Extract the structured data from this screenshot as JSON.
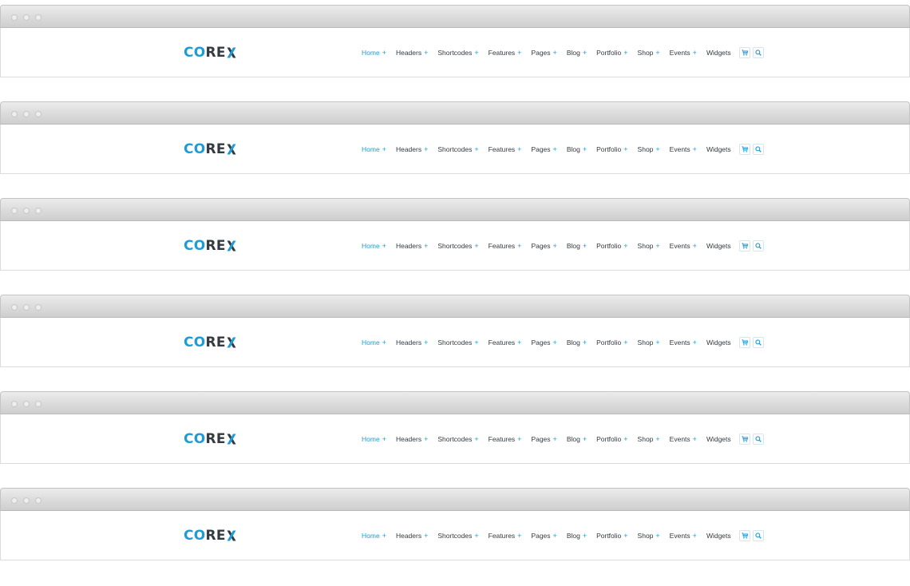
{
  "brand": {
    "logo_co": "CO",
    "logo_re": "RE",
    "accent_color": "#1e9cd7",
    "text_color": "#333a40"
  },
  "menu": {
    "items": [
      {
        "label": "Home",
        "has_plus": true,
        "active": true
      },
      {
        "label": "Headers",
        "has_plus": true,
        "active": false
      },
      {
        "label": "Shortcodes",
        "has_plus": true,
        "active": false
      },
      {
        "label": "Features",
        "has_plus": true,
        "active": false
      },
      {
        "label": "Pages",
        "has_plus": true,
        "active": false
      },
      {
        "label": "Blog",
        "has_plus": true,
        "active": false
      },
      {
        "label": "Portfolio",
        "has_plus": true,
        "active": false
      },
      {
        "label": "Shop",
        "has_plus": true,
        "active": false
      },
      {
        "label": "Events",
        "has_plus": true,
        "active": false
      },
      {
        "label": "Widgets",
        "has_plus": false,
        "active": false
      }
    ],
    "plus_symbol": "+",
    "icons": [
      "cart-icon",
      "search-icon"
    ]
  },
  "frames": [
    {
      "shadow_style": "double-center"
    },
    {
      "shadow_style": "double-center-narrow"
    },
    {
      "shadow_style": "wavy"
    },
    {
      "shadow_style": "full-lifted"
    },
    {
      "shadow_style": "left-curl"
    },
    {
      "shadow_style": "right-curl"
    }
  ]
}
